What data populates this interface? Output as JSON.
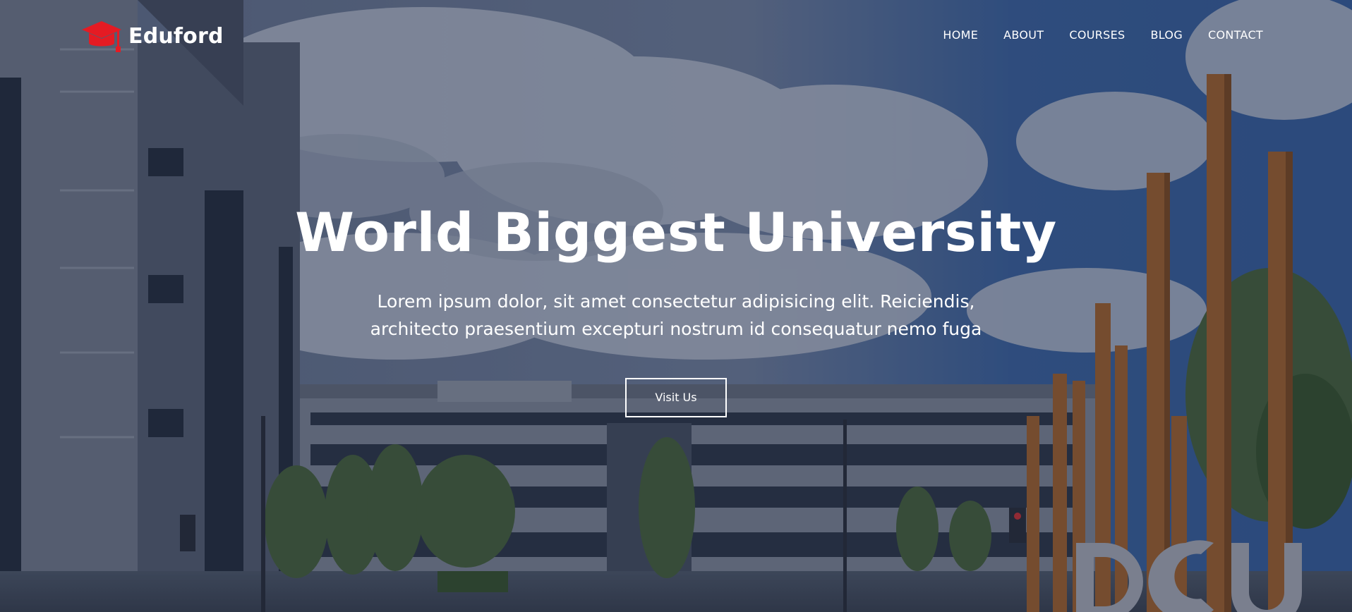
{
  "brand": {
    "name": "Eduford",
    "icon": "graduation-cap-icon",
    "icon_color": "#e51b23"
  },
  "nav": {
    "items": [
      {
        "label": "HOME"
      },
      {
        "label": "ABOUT"
      },
      {
        "label": "COURSES"
      },
      {
        "label": "BLOG"
      },
      {
        "label": "CONTACT"
      }
    ]
  },
  "hero": {
    "title": "World Biggest University",
    "subtitle_line1": "Lorem ipsum dolor, sit amet consectetur adipisicing elit. Reiciendis,",
    "subtitle_line2": "architecto praesentium excepturi nostrum id consequatur nemo fuga",
    "cta_label": "Visit Us",
    "background_sign": "DCU"
  },
  "colors": {
    "accent": "#e51b23",
    "text": "#ffffff"
  }
}
